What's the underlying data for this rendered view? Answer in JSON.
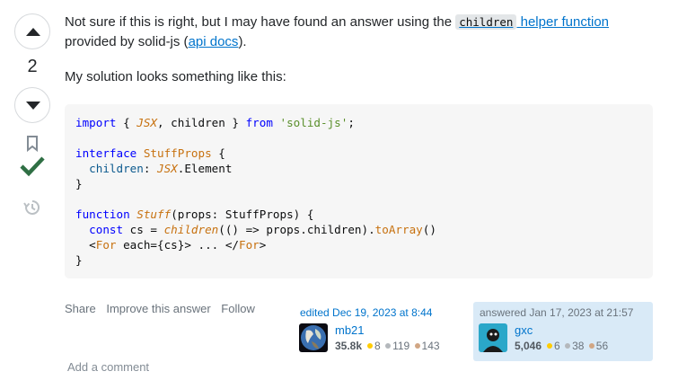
{
  "vote": {
    "count": "2"
  },
  "post": {
    "p1_text_before": "Not sure if this is right, but I may have found an answer using the ",
    "p1_code": "children",
    "p1_link": " helper function",
    "p1_text_mid": "provided by solid-js (",
    "p1_link2": "api docs",
    "p1_text_end": ").",
    "p2": "My solution looks something like this:"
  },
  "code": {
    "line1": [
      "import",
      " { ",
      "JSX",
      ", children } ",
      "from",
      " ",
      "'solid-js'",
      ";"
    ],
    "line3": [
      "interface",
      " ",
      "StuffProps",
      " {"
    ],
    "line4": [
      "  ",
      "children",
      ": ",
      "JSX",
      ".Element"
    ],
    "line5": "}",
    "line7": [
      "function",
      " ",
      "Stuff",
      "(props: StuffProps) {"
    ],
    "line8": [
      "  ",
      "const",
      " cs = ",
      "children",
      "(() => props.children).",
      "toArray",
      "()"
    ],
    "line9": [
      "  <",
      "For",
      " each={cs}> ... </",
      "For",
      ">"
    ],
    "line10": "}"
  },
  "menu": {
    "share": "Share",
    "improve": "Improve this answer",
    "follow": "Follow"
  },
  "edited": {
    "action": "edited Dec 19, 2023 at 8:44",
    "user": "mb21",
    "rep": "35.8k",
    "gold": "8",
    "silver": "119",
    "bronze": "143"
  },
  "answered": {
    "action": "answered Jan 17, 2023 at 21:57",
    "user": "gxc",
    "rep": "5,046",
    "gold": "6",
    "silver": "38",
    "bronze": "56"
  },
  "comment": {
    "add": "Add a comment"
  },
  "colors": {
    "accent": "#0074cc",
    "accepted": "#2f6f44",
    "owner_bg": "#d9eaf7"
  }
}
